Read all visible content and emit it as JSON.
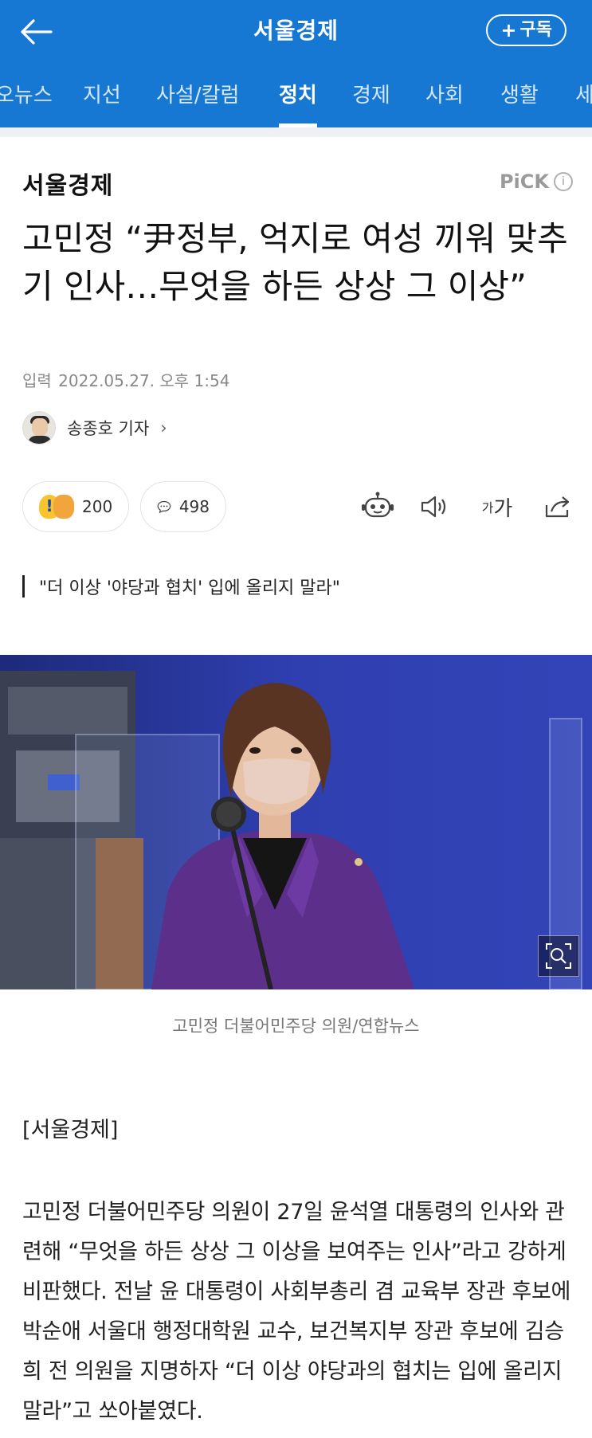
{
  "header": {
    "title": "서울경제",
    "subscribe_label": "구독"
  },
  "tabs": [
    {
      "label": "오뉴스"
    },
    {
      "label": "지선"
    },
    {
      "label": "사설/칼럼"
    },
    {
      "label": "정치",
      "active": true
    },
    {
      "label": "경제"
    },
    {
      "label": "사회"
    },
    {
      "label": "생활"
    },
    {
      "label": "세"
    }
  ],
  "article": {
    "press": "서울경제",
    "pick_label": "PiCK",
    "headline": "고민정 “尹정부, 억지로 여성 끼워 맞추기 인사…무엇을 하든 상상 그 이상”",
    "date_label": "입력",
    "date": "2022.05.27. 오후 1:54",
    "reporter": "송종호 기자",
    "reactions_count": "200",
    "comments_count": "498",
    "font_size_label_small": "가",
    "font_size_label_large": "가",
    "subheading": "\"더 이상 '야당과 협치' 입에 올리지 말라\"",
    "photo_caption": "고민정 더불어민주당 의원/연합뉴스",
    "source": "[서울경제]",
    "paragraph": "고민정 더불어민주당 의원이 27일 윤석열 대통령의 인사와 관련해 “무엇을 하든 상상 그 이상을 보여주는 인사”라고 강하게 비판했다. 전날 윤 대통령이 사회부총리 겸 교육부 장관 후보에 박순애 서울대 행정대학원 교수, 보건복지부 장관 후보에 김승희 전 의원을 지명하자 “더 이상 야당과의 협치는 입에 올리지 말라”고 쏘아붙였다."
  },
  "icons": {
    "back": "arrow-left-icon",
    "bot": "robot-icon",
    "speaker": "speaker-icon",
    "share": "share-icon",
    "zoom": "zoom-icon",
    "comment": "comment-icon"
  },
  "colors": {
    "brand_blue": "#1778d4",
    "background_blue": "#2d3a9e",
    "jacket_purple": "#5b2f8a"
  }
}
